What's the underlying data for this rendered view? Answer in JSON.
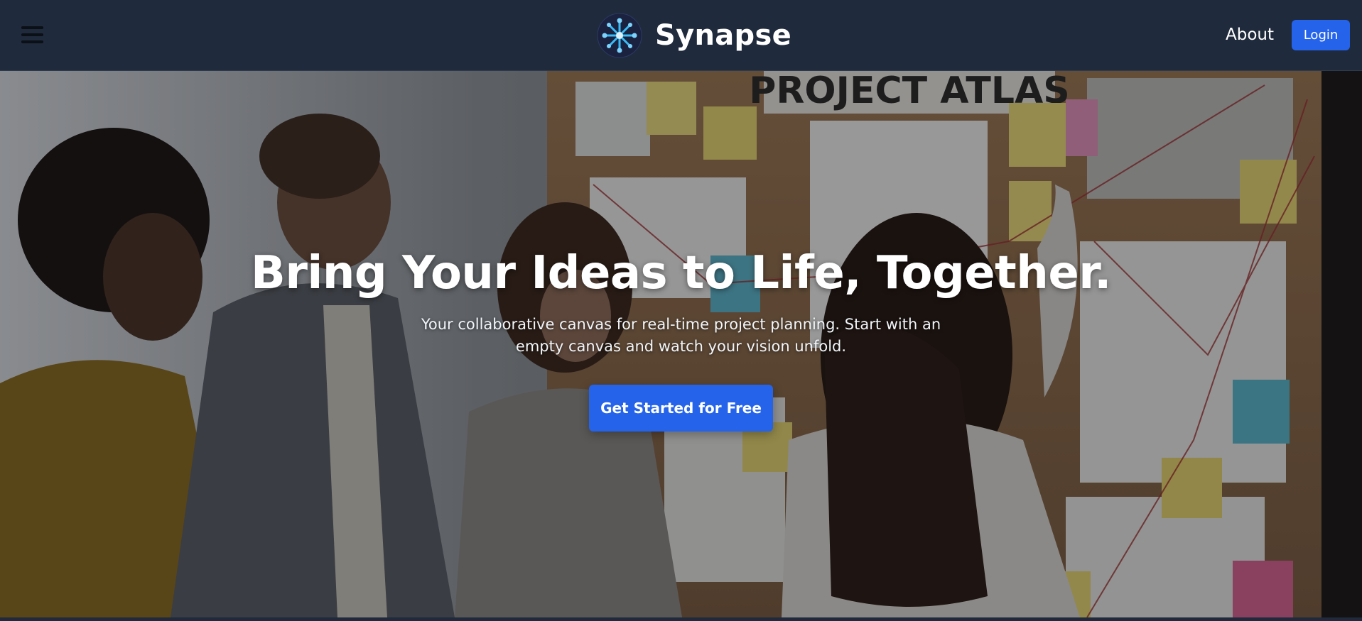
{
  "header": {
    "brand_name": "Synapse",
    "menu_icon": "hamburger-menu-icon",
    "logo_icon": "synapse-network-logo",
    "nav": {
      "about_label": "About",
      "login_label": "Login"
    }
  },
  "hero": {
    "background": "photo-team-planning-at-board",
    "board_sign": "PROJECT ATLAS",
    "title": "Bring Your Ideas to Life, Together.",
    "subtitle": "Your collaborative canvas for real-time project planning. Start with an empty canvas and watch your vision unfold.",
    "cta_label": "Get Started for Free"
  },
  "colors": {
    "header_bg": "#1f2a3c",
    "accent": "#2563eb",
    "text": "#ffffff"
  }
}
